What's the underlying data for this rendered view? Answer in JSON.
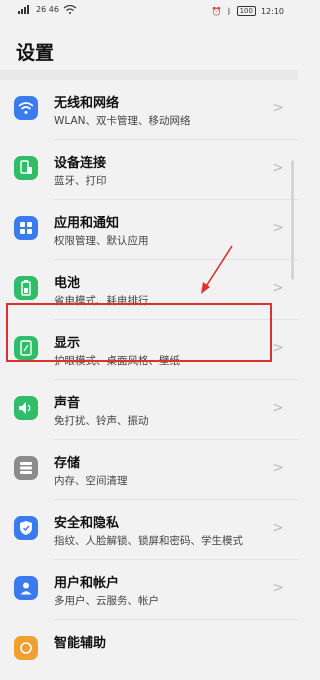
{
  "status_bar": {
    "left_text": "26 46",
    "right_text": "12:10",
    "battery": "100"
  },
  "page_title": "设置",
  "items": [
    {
      "title": "无线和网络",
      "subtitle": "WLAN、双卡管理、移动网络",
      "icon": "wifi-icon",
      "icon_color": "#3b7bf0"
    },
    {
      "title": "设备连接",
      "subtitle": "蓝牙、打印",
      "icon": "device-connect-icon",
      "icon_color": "#2fbd69"
    },
    {
      "title": "应用和通知",
      "subtitle": "权限管理、默认应用",
      "icon": "apps-icon",
      "icon_color": "#3b7bf0"
    },
    {
      "title": "电池",
      "subtitle": "省电模式、耗电排行",
      "icon": "battery-icon",
      "icon_color": "#2fbd69"
    },
    {
      "title": "显示",
      "subtitle": "护眼模式、桌面风格、壁纸",
      "icon": "display-icon",
      "icon_color": "#2fbd69"
    },
    {
      "title": "声音",
      "subtitle": "免打扰、铃声、振动",
      "icon": "sound-icon",
      "icon_color": "#2fbd69"
    },
    {
      "title": "存储",
      "subtitle": "内存、空间清理",
      "icon": "storage-icon",
      "icon_color": "#8c8c8c"
    },
    {
      "title": "安全和隐私",
      "subtitle": "指纹、人脸解锁、锁屏和密码、学生模式",
      "icon": "shield-icon",
      "icon_color": "#3b7bf0"
    },
    {
      "title": "用户和帐户",
      "subtitle": "多用户、云服务、帐户",
      "icon": "user-icon",
      "icon_color": "#3b7bf0"
    },
    {
      "title": "智能辅助",
      "subtitle": "",
      "icon": "assist-icon",
      "icon_color": "#f0a030"
    }
  ],
  "chevron": ">",
  "annotation": {
    "highlight_color": "#e0302d",
    "highlighted_item": "显示"
  }
}
